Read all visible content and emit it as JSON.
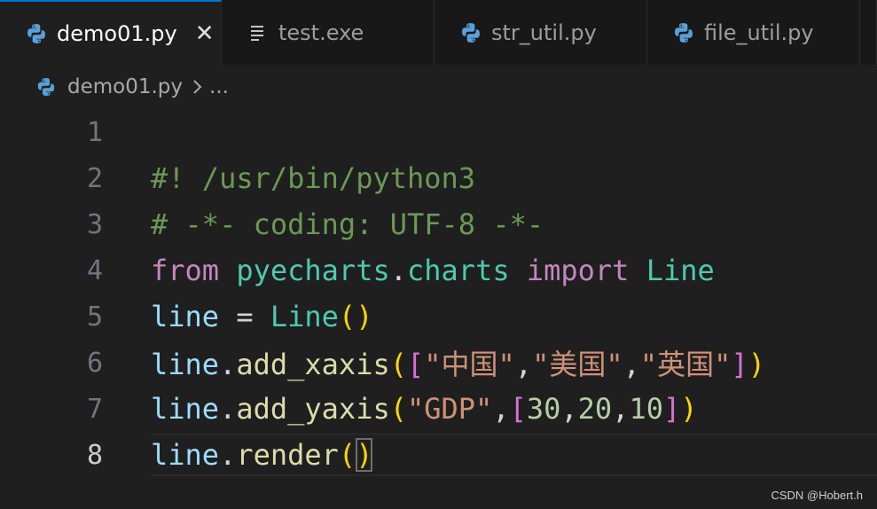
{
  "tabs": [
    {
      "label": "demo01.py",
      "icon": "python-icon",
      "active": true,
      "close": "✕"
    },
    {
      "label": "test.exe",
      "icon": "file-lines-icon",
      "active": false
    },
    {
      "label": "str_util.py",
      "icon": "python-icon",
      "active": false
    },
    {
      "label": "file_util.py",
      "icon": "python-icon",
      "active": false
    }
  ],
  "breadcrumb": {
    "file": "demo01.py",
    "more": "..."
  },
  "editor": {
    "line_numbers": [
      "1",
      "2",
      "3",
      "4",
      "5",
      "6",
      "7",
      "8"
    ],
    "current_line": "8",
    "lines": {
      "l2": "#! /usr/bin/python3",
      "l3": "# -*- coding: UTF-8 -*-",
      "l4": {
        "from": "from",
        "module1": "pyecharts",
        "dot": ".",
        "module2": "charts",
        "import": "import",
        "cls": "Line"
      },
      "l5": {
        "var": "line",
        "eq": " = ",
        "cls": "Line",
        "open": "(",
        "close": ")"
      },
      "l6": {
        "var": "line",
        "dot": ".",
        "func": "add_xaxis",
        "open": "(",
        "lbr": "[",
        "s1": "\"中国\"",
        "c1": ",",
        "s2": "\"美国\"",
        "c2": ",",
        "s3": "\"英国\"",
        "rbr": "]",
        "close": ")"
      },
      "l7": {
        "var": "line",
        "dot": ".",
        "func": "add_yaxis",
        "open": "(",
        "s1": "\"GDP\"",
        "c1": ",",
        "lbr": "[",
        "n1": "30",
        "c2": ",",
        "n2": "20",
        "c3": ",",
        "n3": "10",
        "rbr": "]",
        "close": ")"
      },
      "l8": {
        "var": "line",
        "dot": ".",
        "func": "render",
        "open": "(",
        "close": ")"
      }
    }
  },
  "watermark": "CSDN @Hobert.h"
}
